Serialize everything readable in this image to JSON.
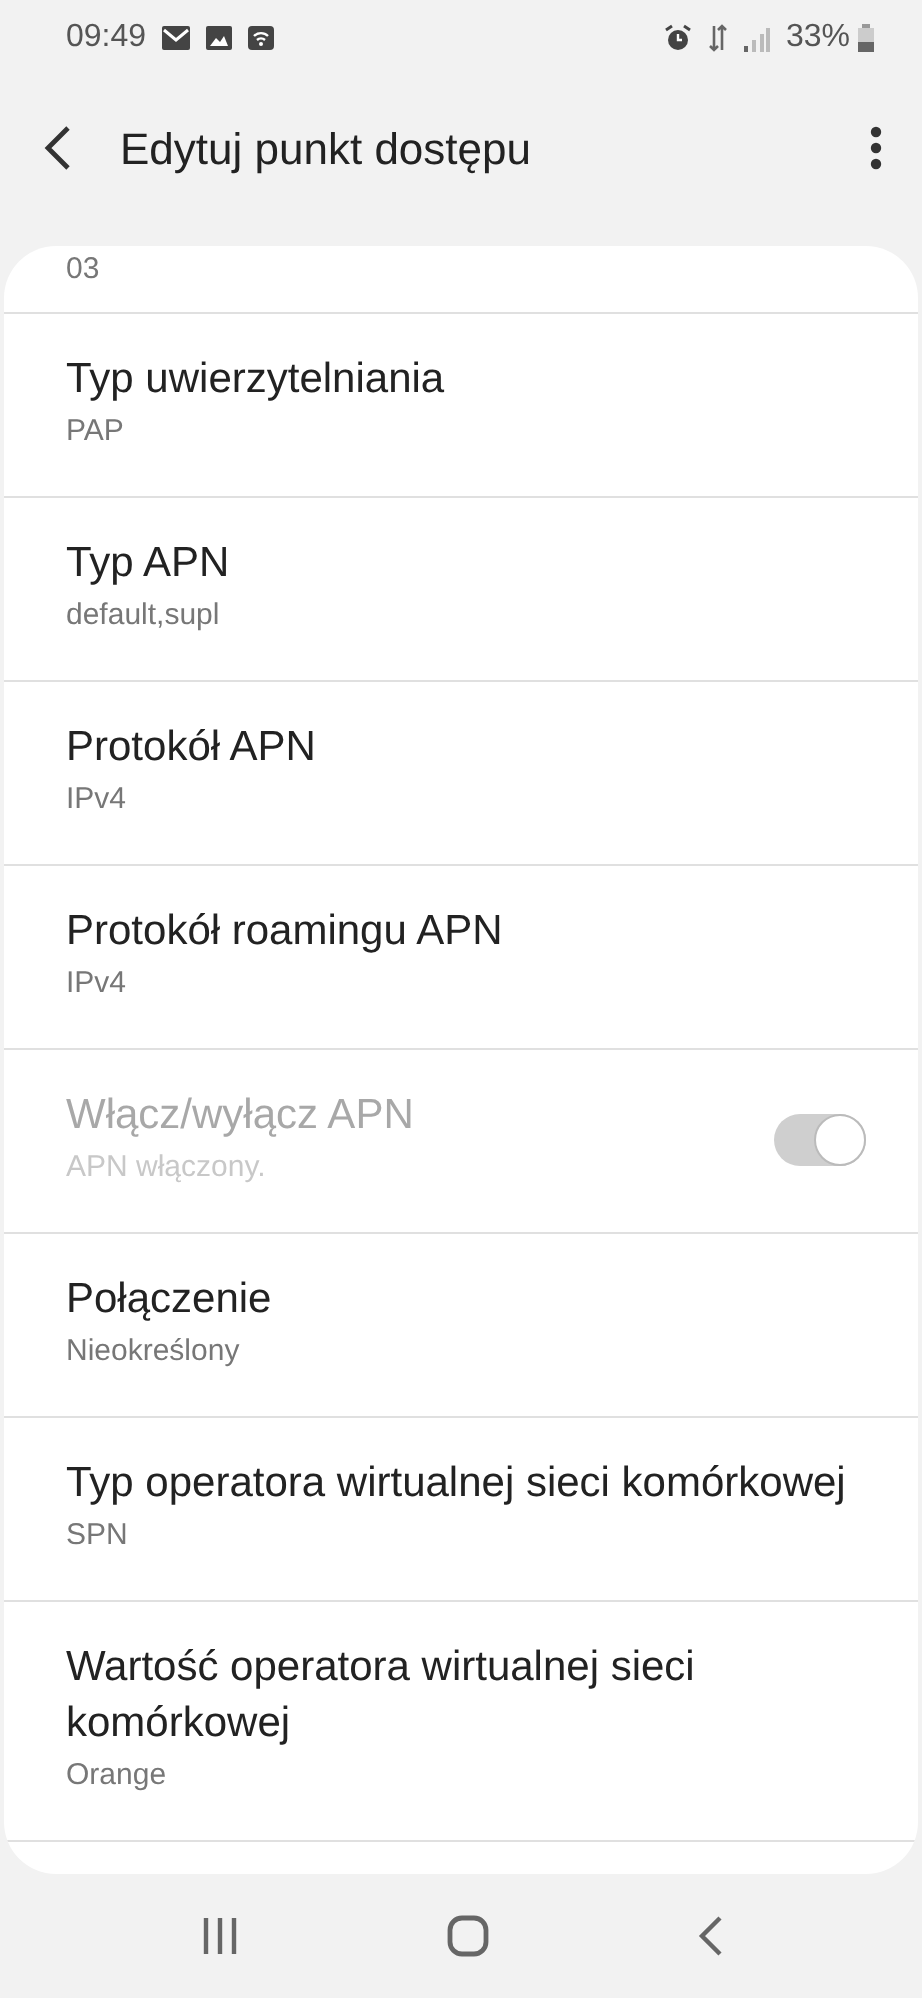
{
  "status_bar": {
    "time": "09:49",
    "battery": "33%"
  },
  "header": {
    "title": "Edytuj punkt dostępu"
  },
  "items": [
    {
      "kind": "value",
      "value": "03",
      "disabled": false
    },
    {
      "kind": "value",
      "title": "Typ uwierzytelniania",
      "value": "PAP",
      "disabled": false
    },
    {
      "kind": "value",
      "title": "Typ APN",
      "value": "default,supl",
      "disabled": false
    },
    {
      "kind": "value",
      "title": "Protokół APN",
      "value": "IPv4",
      "disabled": false
    },
    {
      "kind": "value",
      "title": "Protokół roamingu APN",
      "value": "IPv4",
      "disabled": false
    },
    {
      "kind": "switch",
      "title": "Włącz/wyłącz APN",
      "value": "APN włączony.",
      "disabled": true,
      "on": true
    },
    {
      "kind": "value",
      "title": "Połączenie",
      "value": "Nieokreślony",
      "disabled": false
    },
    {
      "kind": "value",
      "title": "Typ operatora wirtualnej sieci komórkowej",
      "value": "SPN",
      "disabled": false
    },
    {
      "kind": "value",
      "title": "Wartość operatora wirtualnej sieci komórkowej",
      "value": "Orange",
      "disabled": false
    }
  ]
}
